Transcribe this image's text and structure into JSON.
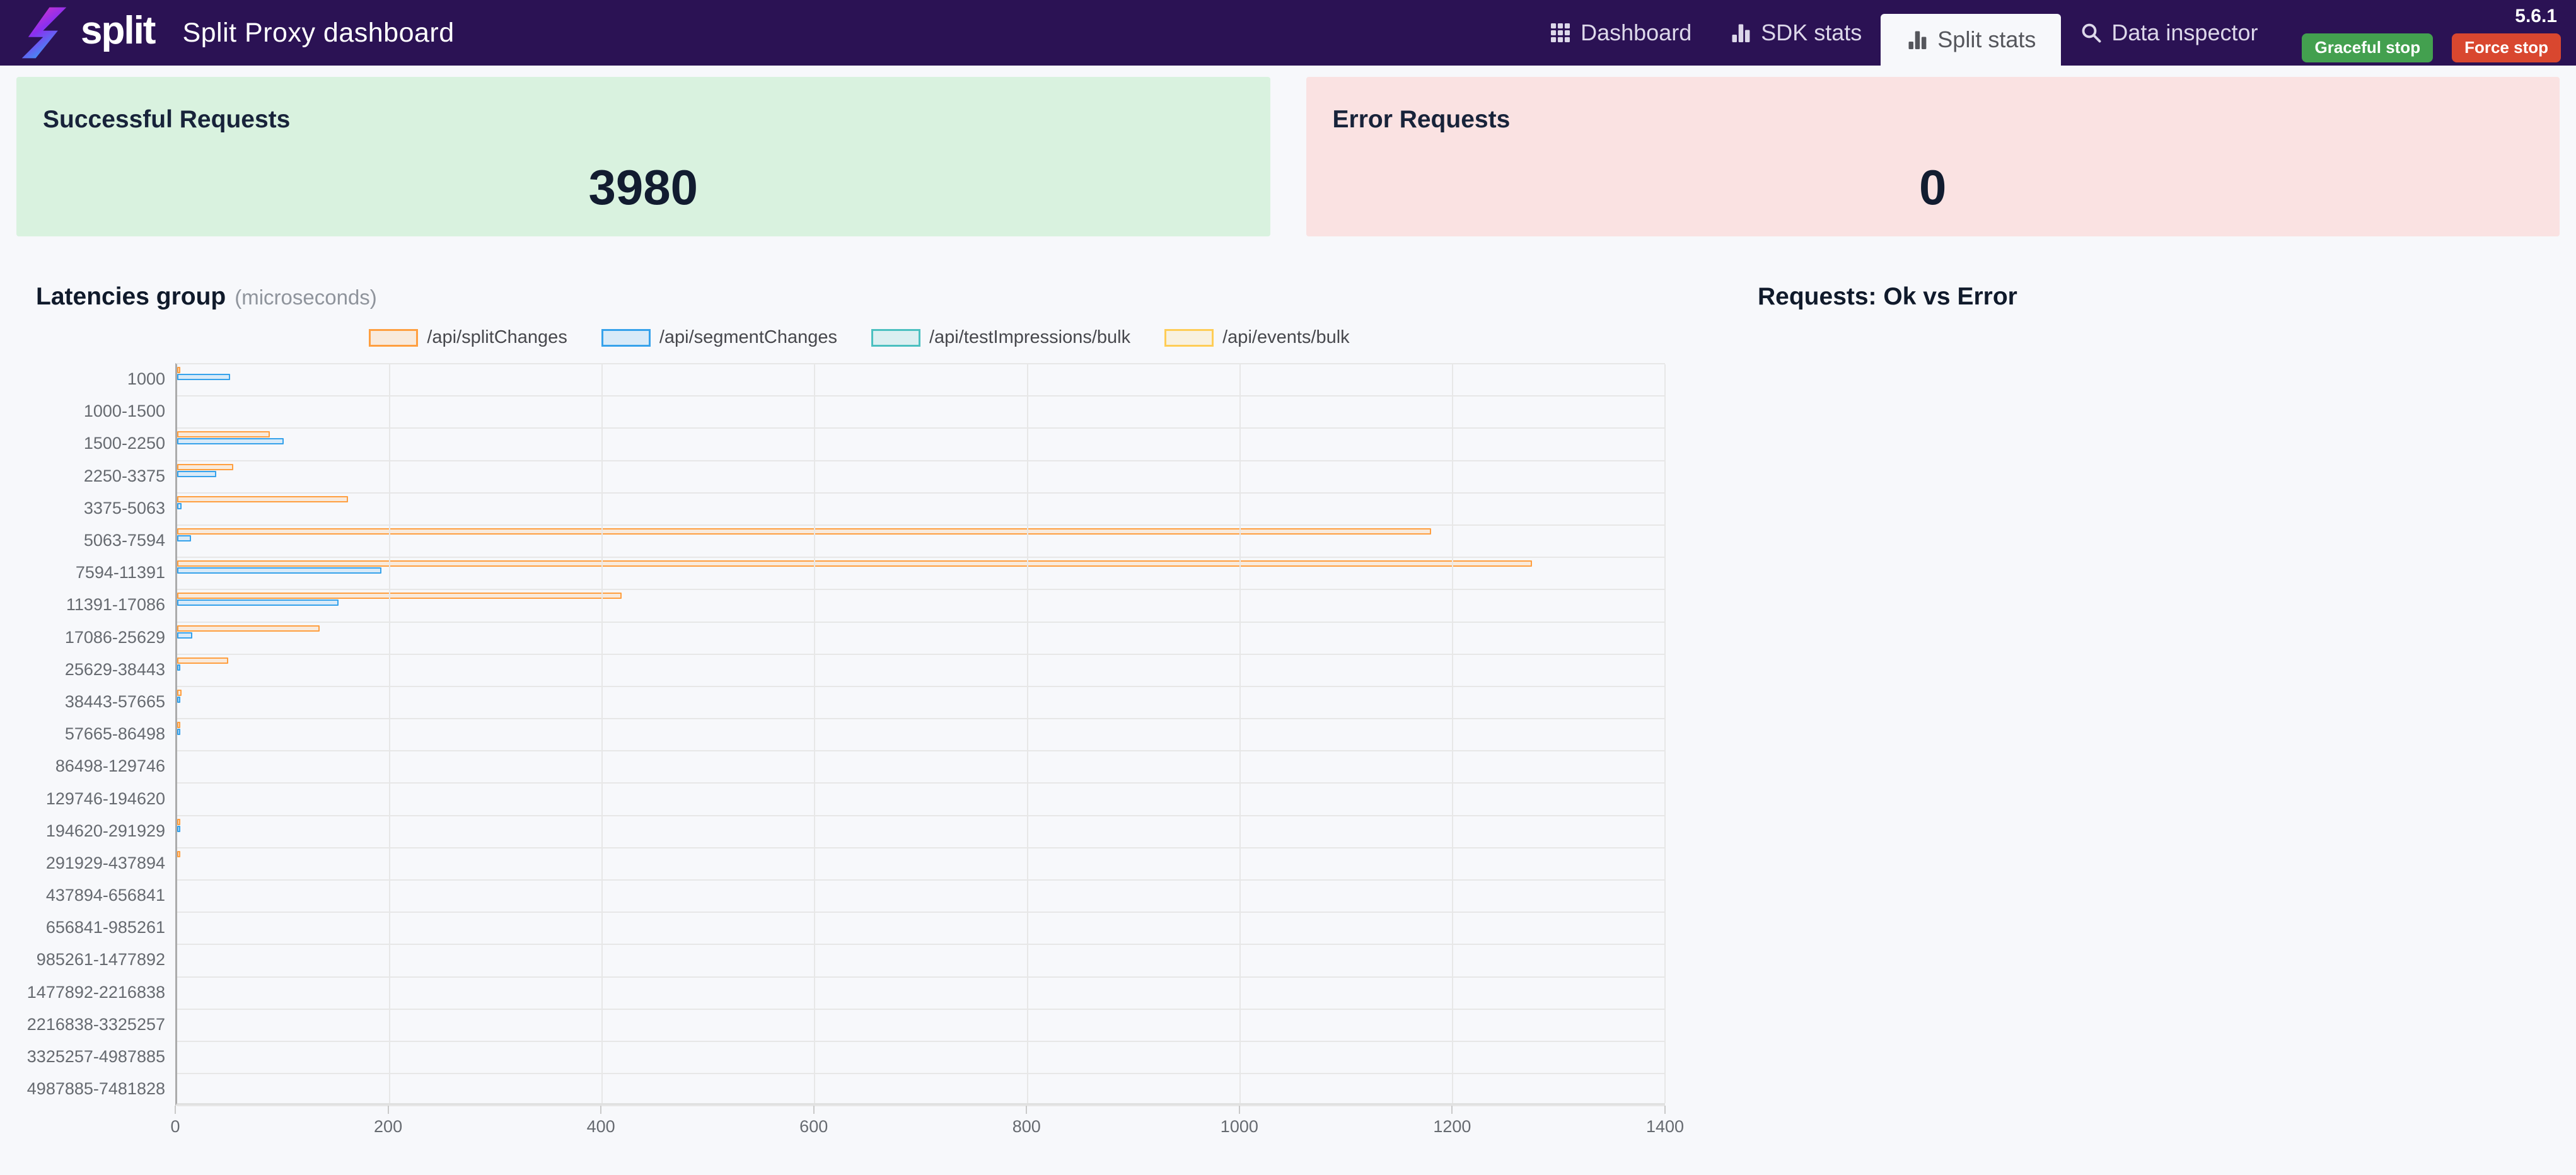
{
  "header": {
    "brand": "split",
    "title": "Split Proxy dashboard",
    "version": "5.6.1",
    "graceful_stop_label": "Graceful stop",
    "force_stop_label": "Force stop"
  },
  "nav": {
    "items": [
      {
        "label": "Dashboard",
        "icon": "grid-icon",
        "active": false
      },
      {
        "label": "SDK stats",
        "icon": "bar-chart-icon",
        "active": false
      },
      {
        "label": "Split stats",
        "icon": "bar-chart-icon",
        "active": true
      },
      {
        "label": "Data inspector",
        "icon": "search-icon",
        "active": false
      }
    ]
  },
  "cards": {
    "success": {
      "label": "Successful Requests",
      "value": "3980"
    },
    "error": {
      "label": "Error Requests",
      "value": "0"
    }
  },
  "sections": {
    "latencies": {
      "title": "Latencies group",
      "subtitle": "(microseconds)"
    },
    "requests": {
      "title": "Requests: Ok vs Error"
    }
  },
  "colors": {
    "navbar": "#2b1254",
    "success_card_bg": "#d9f2df",
    "error_card_bg": "#fae2e2",
    "graceful_btn": "#43a04f",
    "force_btn": "#d9472f",
    "series_orange": "#ff9f40",
    "series_blue": "#36a2eb",
    "series_teal": "#4bc0c0",
    "series_yellow": "#ffcd56"
  },
  "chart_data": [
    {
      "type": "bar",
      "orientation": "horizontal",
      "title": "Latencies group",
      "subtitle": "(microseconds)",
      "legend_position": "top",
      "grid": true,
      "xlim": [
        0,
        1400
      ],
      "x_ticks": [
        0,
        200,
        400,
        600,
        800,
        1000,
        1200,
        1400
      ],
      "categories": [
        "1000",
        "1000-1500",
        "1500-2250",
        "2250-3375",
        "3375-5063",
        "5063-7594",
        "7594-11391",
        "11391-17086",
        "17086-25629",
        "25629-38443",
        "38443-57665",
        "57665-86498",
        "86498-129746",
        "129746-194620",
        "194620-291929",
        "291929-437894",
        "437894-656841",
        "656841-985261",
        "985261-1477892",
        "1477892-2216838",
        "2216838-3325257",
        "3325257-4987885",
        "4987885-7481828"
      ],
      "series": [
        {
          "name": "/api/splitChanges",
          "color": "#ff9f40",
          "fill": "rgba(255,159,64,0.16)",
          "values": [
            2,
            0,
            87,
            53,
            161,
            1180,
            1275,
            418,
            134,
            48,
            4,
            2,
            0,
            0,
            2,
            1,
            0,
            0,
            0,
            0,
            0,
            0,
            0
          ]
        },
        {
          "name": "/api/segmentChanges",
          "color": "#36a2eb",
          "fill": "rgba(54,162,235,0.16)",
          "values": [
            50,
            0,
            100,
            37,
            4,
            13,
            192,
            152,
            14,
            2,
            1,
            1,
            0,
            0,
            1,
            0,
            0,
            0,
            0,
            0,
            0,
            0,
            0
          ]
        },
        {
          "name": "/api/testImpressions/bulk",
          "color": "#4bc0c0",
          "fill": "rgba(75,192,192,0.16)",
          "values": [
            0,
            0,
            0,
            0,
            0,
            0,
            0,
            0,
            0,
            0,
            0,
            0,
            0,
            0,
            0,
            0,
            0,
            0,
            0,
            0,
            0,
            0,
            0
          ]
        },
        {
          "name": "/api/events/bulk",
          "color": "#ffcd56",
          "fill": "rgba(255,205,86,0.16)",
          "values": [
            0,
            0,
            0,
            0,
            0,
            0,
            0,
            0,
            0,
            0,
            0,
            0,
            0,
            0,
            0,
            0,
            0,
            0,
            0,
            0,
            0,
            0,
            0
          ]
        }
      ]
    },
    {
      "type": "pie",
      "title": "Requests: Ok vs Error",
      "series": [],
      "values": []
    }
  ]
}
